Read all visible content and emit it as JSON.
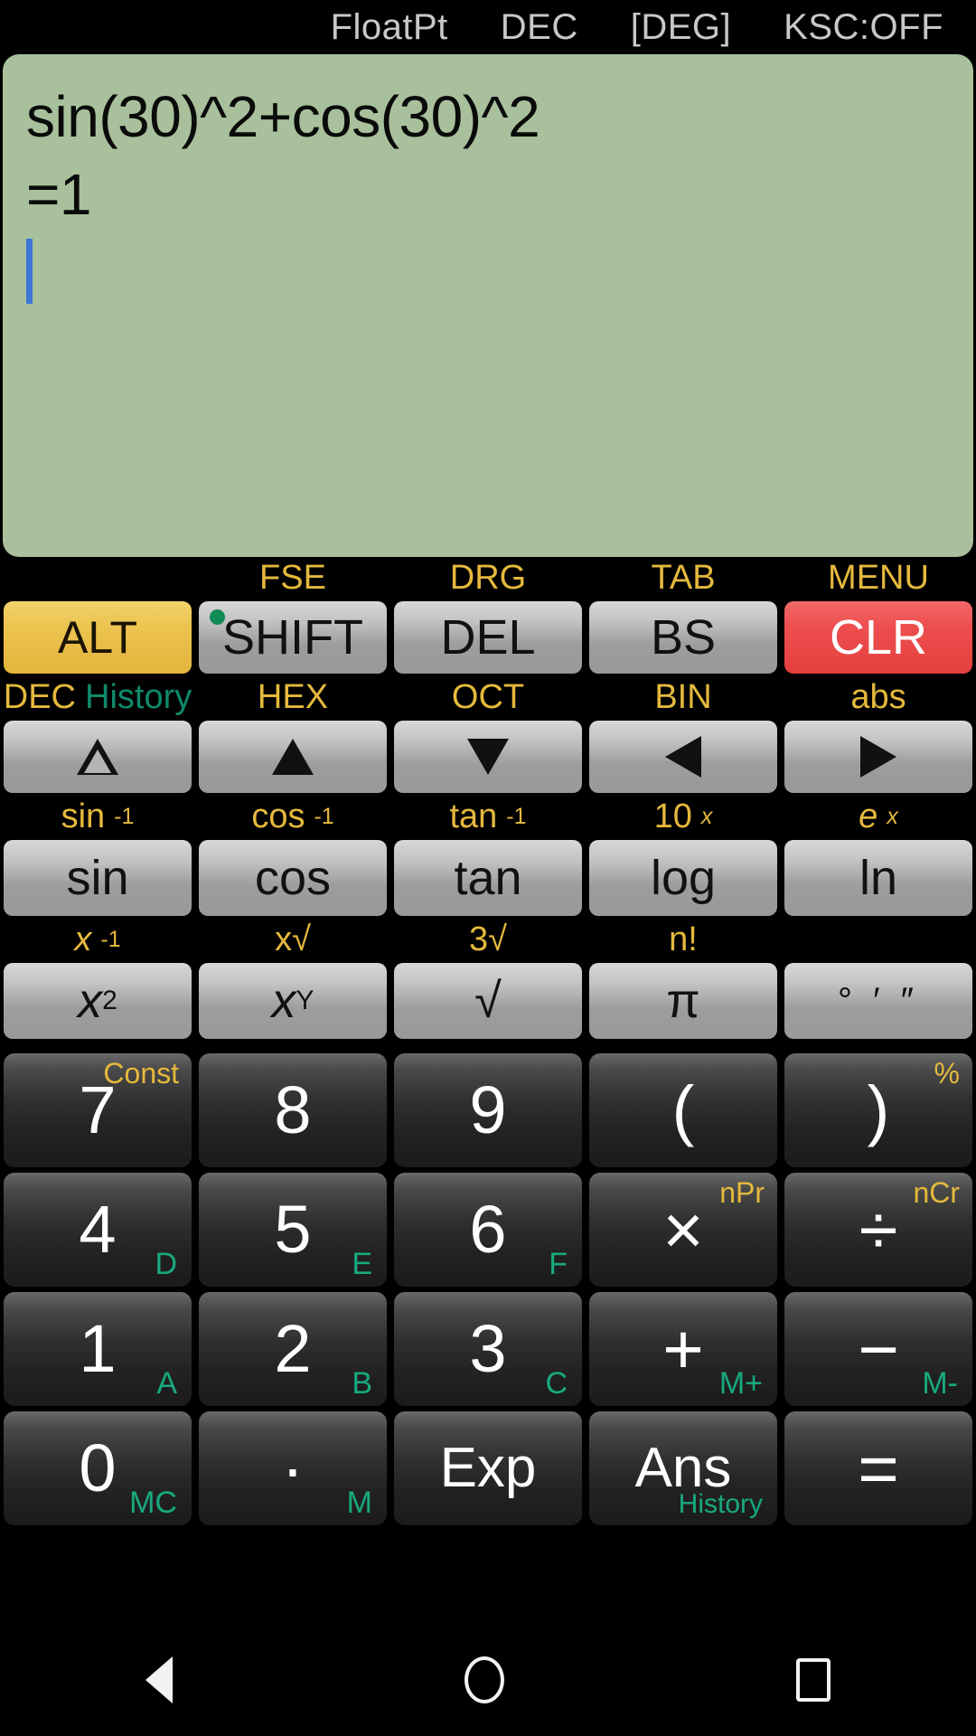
{
  "status": {
    "mode": "FloatPt",
    "base": "DEC",
    "angle": "[DEG]",
    "ksc": "KSC:OFF"
  },
  "display": {
    "expression": "sin(30)^2+cos(30)^2",
    "result": "=1",
    "cursor_visible": true,
    "background_color": "#a8c09c",
    "cursor_color": "#3f76d8"
  },
  "colors": {
    "alt_key": "#e8c04a",
    "clr_key": "#ee4e4e",
    "shift_indicator": "#118a55",
    "caption_yellow": "#e5b93c",
    "sublabel_teal": "#18a97f",
    "gray_key": "#b4b4b4",
    "dark_key": "#2a2a2a"
  },
  "keypad": {
    "row1": [
      {
        "cap": "",
        "label": "ALT",
        "style": "amber",
        "name": "alt-key"
      },
      {
        "cap": "FSE",
        "label": "SHIFT",
        "style": "gray",
        "name": "shift-key",
        "led": true
      },
      {
        "cap": "DRG",
        "label": "DEL",
        "style": "gray",
        "name": "del-key"
      },
      {
        "cap": "TAB",
        "label": "BS",
        "style": "gray",
        "name": "backspace-key"
      },
      {
        "cap": "MENU",
        "label": "CLR",
        "style": "red",
        "name": "clr-key"
      }
    ],
    "row2": [
      {
        "cap": "DEC",
        "cap2": "History",
        "icon": "triangle-up-hollow-icon",
        "name": "page-up-key"
      },
      {
        "cap": "HEX",
        "icon": "triangle-up-icon",
        "name": "arrow-up-key"
      },
      {
        "cap": "OCT",
        "icon": "triangle-down-icon",
        "name": "arrow-down-key"
      },
      {
        "cap": "BIN",
        "icon": "triangle-left-icon",
        "name": "arrow-left-key"
      },
      {
        "cap": "abs",
        "icon": "triangle-right-icon",
        "name": "arrow-right-key"
      }
    ],
    "row3": [
      {
        "cap_base": "sin",
        "cap_sup": "-1",
        "label": "sin",
        "name": "sin-key"
      },
      {
        "cap_base": "cos",
        "cap_sup": "-1",
        "label": "cos",
        "name": "cos-key"
      },
      {
        "cap_base": "tan",
        "cap_sup": "-1",
        "label": "tan",
        "name": "tan-key"
      },
      {
        "cap_base": "10",
        "cap_sup": "x",
        "label": "log",
        "name": "log-key"
      },
      {
        "cap_base": "e",
        "cap_sup": "x",
        "label": "ln",
        "name": "ln-key"
      }
    ],
    "row4": [
      {
        "cap_base": "x",
        "cap_sup": "-1",
        "label_base": "x",
        "label_sup": "2",
        "name": "x-squared-key"
      },
      {
        "cap_base": "x√",
        "cap_sup": "",
        "label_base": "x",
        "label_sup": "Y",
        "name": "x-power-y-key"
      },
      {
        "cap_base": "3√",
        "cap_sup": "",
        "label_base": "√",
        "label_sup": "",
        "name": "square-root-key"
      },
      {
        "cap_base": "n!",
        "cap_sup": "",
        "label_base": "π",
        "label_sup": "",
        "name": "pi-key"
      },
      {
        "cap_base": "",
        "cap_sup": "",
        "label_base": "° ′ ″",
        "label_sup": "",
        "name": "dms-key"
      }
    ],
    "row5": [
      {
        "label": "7",
        "tr": "Const",
        "br": "",
        "name": "seven-key"
      },
      {
        "label": "8",
        "tr": "",
        "br": "",
        "name": "eight-key"
      },
      {
        "label": "9",
        "tr": "",
        "br": "",
        "name": "nine-key"
      },
      {
        "label": "(",
        "tr": "",
        "br": "",
        "name": "open-paren-key"
      },
      {
        "label": ")",
        "tr": "%",
        "br": "",
        "name": "close-paren-key"
      }
    ],
    "row6": [
      {
        "label": "4",
        "tr": "",
        "br": "D",
        "name": "four-key"
      },
      {
        "label": "5",
        "tr": "",
        "br": "E",
        "name": "five-key"
      },
      {
        "label": "6",
        "tr": "",
        "br": "F",
        "name": "six-key"
      },
      {
        "label": "×",
        "tr": "nPr",
        "br": "",
        "name": "multiply-key"
      },
      {
        "label": "÷",
        "tr": "nCr",
        "br": "",
        "name": "divide-key"
      }
    ],
    "row7": [
      {
        "label": "1",
        "tr": "",
        "br": "A",
        "name": "one-key"
      },
      {
        "label": "2",
        "tr": "",
        "br": "B",
        "name": "two-key"
      },
      {
        "label": "3",
        "tr": "",
        "br": "C",
        "name": "three-key"
      },
      {
        "label": "+",
        "tr": "",
        "br": "M+",
        "name": "plus-key"
      },
      {
        "label": "−",
        "tr": "",
        "br": "M-",
        "name": "minus-key"
      }
    ],
    "row8": [
      {
        "label": "0",
        "tr": "",
        "br": "MC",
        "name": "zero-key"
      },
      {
        "label": "·",
        "tr": "",
        "br": "M",
        "name": "decimal-point-key"
      },
      {
        "label": "Exp",
        "tr": "",
        "br": "",
        "name": "exp-key"
      },
      {
        "label": "Ans",
        "tr": "",
        "br": "History",
        "name": "ans-key"
      },
      {
        "label": "=",
        "tr": "",
        "br": "",
        "name": "equals-key"
      }
    ]
  },
  "navbar": {
    "back": "back-icon",
    "home": "home-icon",
    "recents": "recents-icon"
  }
}
